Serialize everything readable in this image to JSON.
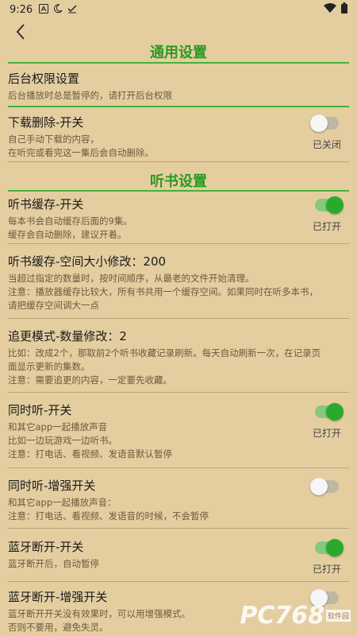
{
  "status_bar": {
    "time": "9:26",
    "icons": [
      "a-icon",
      "moon-icon",
      "check-icon"
    ],
    "right_icons": [
      "wifi-icon",
      "battery-icon"
    ]
  },
  "nav": {
    "back_icon": "chevron-left-icon"
  },
  "sections": [
    {
      "title": "通用设置"
    },
    {
      "title": "听书设置"
    }
  ],
  "items": [
    {
      "title": "后台权限设置",
      "desc": [
        "后台播放时总是暂停的，请打开后台权限"
      ]
    },
    {
      "title": "下载删除-开关",
      "desc": [
        "自己手动下载的内容，",
        "在听完或看完这一集后会自动删除。"
      ],
      "toggle": false,
      "toggle_label": "已关闭"
    },
    {
      "title": "听书缓存-开关",
      "desc": [
        "每本书会自动缓存后面的9集。",
        "缓存会自动删除，建议开着。"
      ],
      "toggle": true,
      "toggle_label": "已打开"
    },
    {
      "title": "听书缓存-空间大小修改：200",
      "desc": [
        "当超过指定的数量时，按时间顺序，从最老的文件开始清理。",
        "注意：播放器缓存比较大，所有书共用一个缓存空间。如果同时在听多本书，",
        "请把缓存空间调大一点"
      ]
    },
    {
      "title": "追更模式-数量修改：2",
      "desc": [
        "比如：改成2个，那取前2个听书收藏记录刷新。每天自动刷新一次，在记录页",
        "面显示更新的集数。",
        "注意：需要追更的内容，一定要先收藏。"
      ]
    },
    {
      "title": "同时听-开关",
      "desc": [
        "和其它app一起播放声音",
        "比如一边玩游戏一边听书。",
        "注意：打电话、看视频、发语音默认暂停"
      ],
      "toggle": true,
      "toggle_label": "已打开"
    },
    {
      "title": "同时听-增强开关",
      "desc": [
        "和其它app一起播放声音：",
        "注意：打电话、看视频、发语音的时候，不会暂停"
      ],
      "toggle": false,
      "toggle_label": ""
    },
    {
      "title": "蓝牙断开-开关",
      "desc": [
        "蓝牙断开后，自动暂停"
      ],
      "toggle": true,
      "toggle_label": "已打开"
    },
    {
      "title": "蓝牙断开-增强开关",
      "desc": [
        "蓝牙断开开关没有效果时，可以用增强模式。",
        "否则不要用，避免失灵。"
      ],
      "toggle": false,
      "toggle_label": ""
    }
  ],
  "watermark": {
    "text": "PC768",
    "sub": "软件园"
  },
  "colors": {
    "background": "#e4cea0",
    "accent_green": "#2a9a22",
    "toggle_on": "#2aaa2a"
  }
}
